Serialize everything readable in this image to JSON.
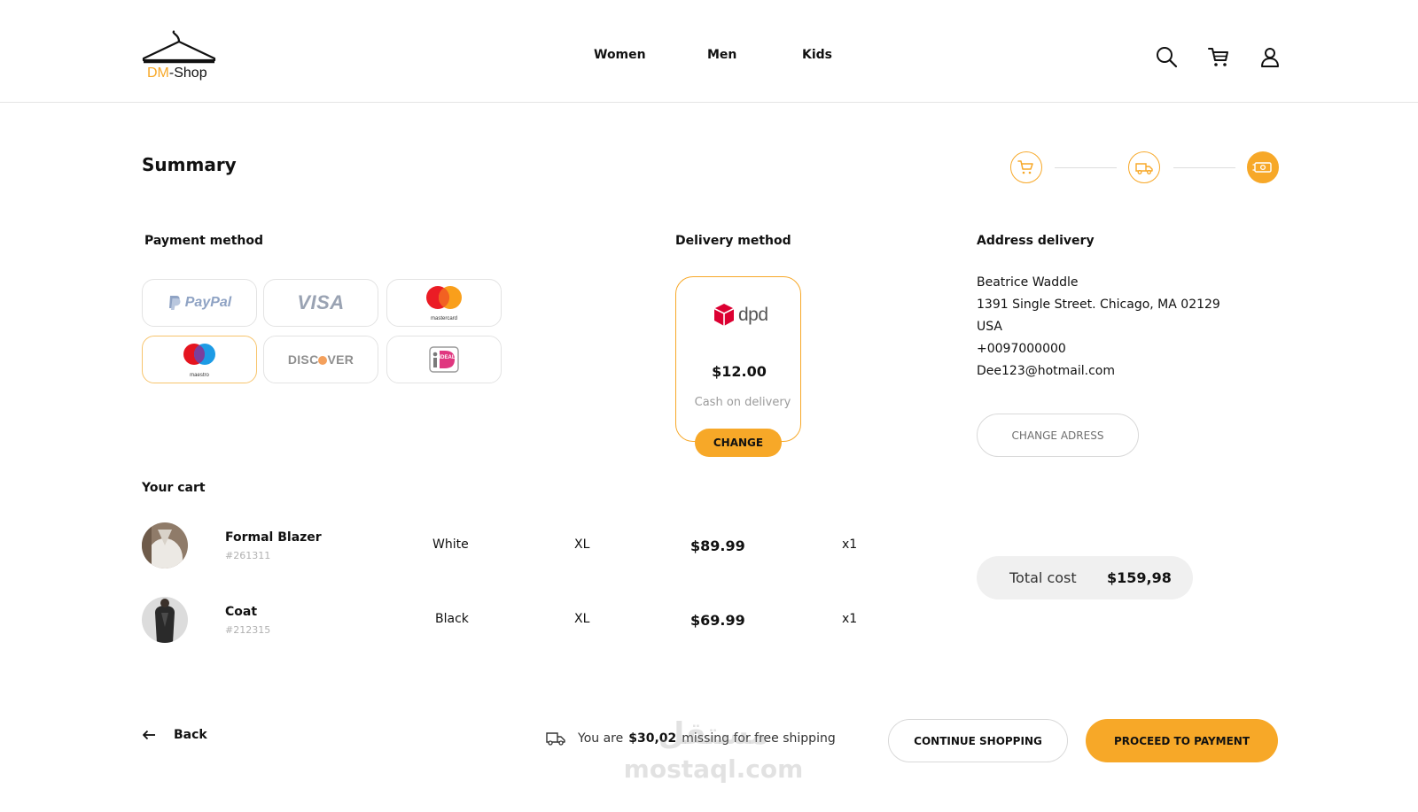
{
  "brand": {
    "name_prefix": "DM",
    "name_suffix": "-Shop",
    "accent_color": "#f7a828"
  },
  "nav": {
    "items": [
      "Women",
      "Men",
      "Kids"
    ]
  },
  "header_icons": [
    "search-icon",
    "cart-icon",
    "user-icon"
  ],
  "page": {
    "title": "Summary"
  },
  "stepper": {
    "steps": [
      "cart-icon",
      "delivery-truck-icon",
      "payment-icon"
    ],
    "active_step": 3
  },
  "payment": {
    "heading": "Payment method",
    "methods": [
      {
        "label": "PayPal",
        "selected": false
      },
      {
        "label": "VISA",
        "selected": false
      },
      {
        "label": "mastercard",
        "selected": false
      },
      {
        "label": "maestro",
        "selected": true
      },
      {
        "label": "DISCOVER",
        "selected": false
      },
      {
        "label": "iDEAL",
        "selected": false
      }
    ]
  },
  "delivery": {
    "heading": "Delivery method",
    "carrier": "dpd",
    "price": "$12.00",
    "note": "Cash on delivery",
    "change_label": "CHANGE"
  },
  "address": {
    "heading": "Address delivery",
    "lines": [
      "Beatrice Waddle",
      "1391 Single Street. Chicago, MA 02129",
      "USA",
      "+0097000000",
      "Dee123@hotmail.com"
    ],
    "change_label": "CHANGE ADRESS"
  },
  "cart": {
    "heading": "Your cart",
    "items": [
      {
        "name": "Formal Blazer",
        "sku": "#261311",
        "color": "White",
        "size": "XL",
        "price": "$89.99",
        "qty": "x1"
      },
      {
        "name": "Coat",
        "sku": "#212315",
        "color": "Black",
        "size": "XL",
        "price": "$69.99",
        "qty": "x1"
      }
    ]
  },
  "total": {
    "label": "Total cost",
    "value": "$159,98"
  },
  "footer": {
    "back_label": "Back",
    "shipping_prefix": "You are",
    "shipping_amount": "$30,02",
    "shipping_suffix": "missing for free shipping",
    "continue_label": "CONTINUE SHOPPING",
    "proceed_label": "PROCEED TO PAYMENT"
  },
  "watermark": {
    "arabic": "مستقل",
    "latin": "mostaql.com"
  }
}
